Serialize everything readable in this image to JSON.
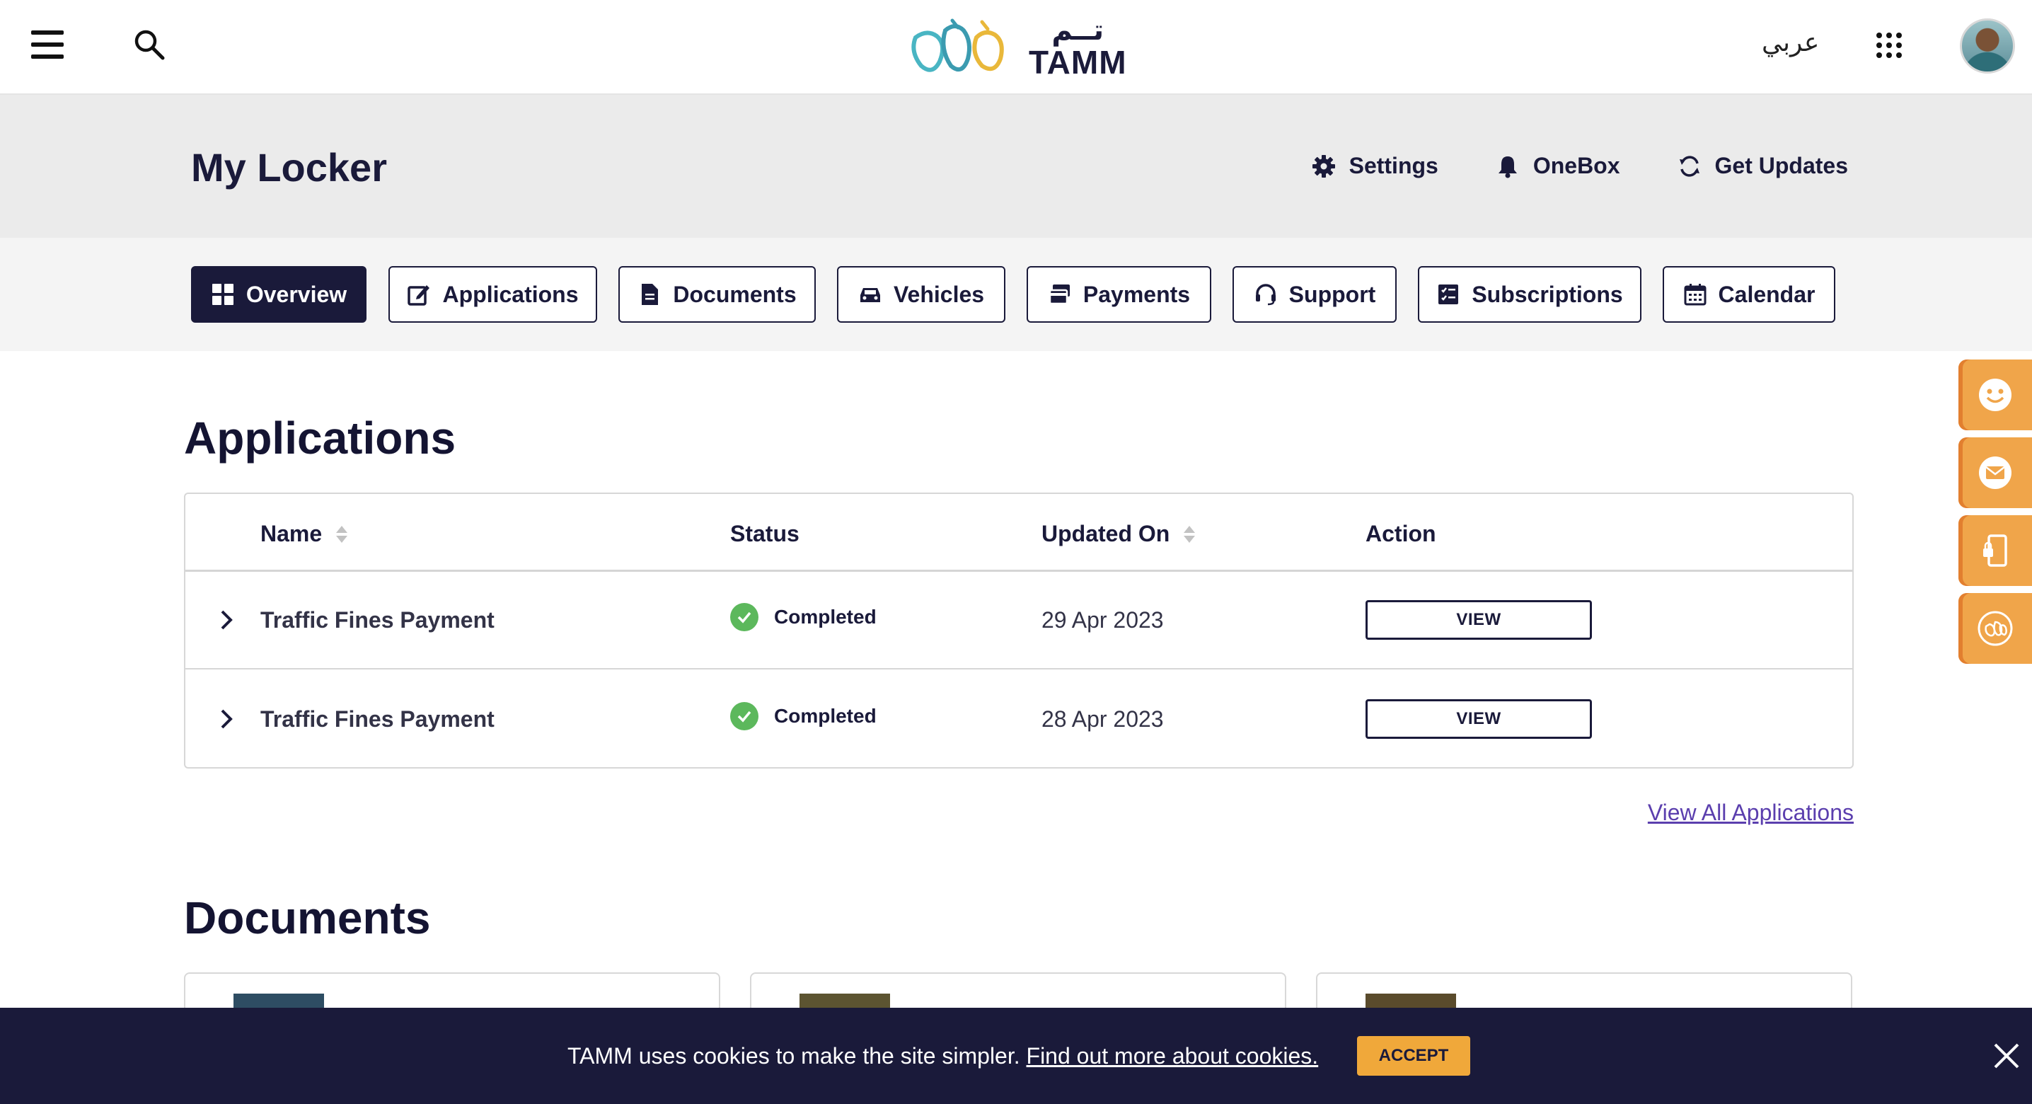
{
  "header": {
    "logo_arabic": "تــم",
    "logo_text": "TAMM",
    "language_toggle": "عربي"
  },
  "locker": {
    "title": "My Locker",
    "actions": [
      {
        "label": "Settings",
        "icon": "gear-icon"
      },
      {
        "label": "OneBox",
        "icon": "bell-icon"
      },
      {
        "label": "Get Updates",
        "icon": "refresh-icon"
      }
    ]
  },
  "tabs": [
    {
      "label": "Overview",
      "icon": "grid-icon",
      "active": true
    },
    {
      "label": "Applications",
      "icon": "edit-icon",
      "active": false
    },
    {
      "label": "Documents",
      "icon": "document-icon",
      "active": false
    },
    {
      "label": "Vehicles",
      "icon": "car-icon",
      "active": false
    },
    {
      "label": "Payments",
      "icon": "payments-icon",
      "active": false
    },
    {
      "label": "Support",
      "icon": "headset-icon",
      "active": false
    },
    {
      "label": "Subscriptions",
      "icon": "checklist-icon",
      "active": false
    },
    {
      "label": "Calendar",
      "icon": "calendar-icon",
      "active": false
    }
  ],
  "applications": {
    "title": "Applications",
    "columns": {
      "name": "Name",
      "status": "Status",
      "updated": "Updated On",
      "action": "Action"
    },
    "rows": [
      {
        "name": "Traffic Fines Payment",
        "status": "Completed",
        "updated": "29 Apr 2023",
        "action": "VIEW"
      },
      {
        "name": "Traffic Fines Payment",
        "status": "Completed",
        "updated": "28 Apr 2023",
        "action": "VIEW"
      }
    ],
    "view_all": "View All Applications"
  },
  "documents": {
    "title": "Documents",
    "thumb_colors": [
      "#2e4d63",
      "#5c5431",
      "#5a4b2c"
    ]
  },
  "cookie": {
    "text": "TAMM uses cookies to make the site simpler.",
    "link": "Find out more about cookies.",
    "accept": "ACCEPT"
  },
  "side_buttons": [
    "smiley-icon",
    "mail-icon",
    "mobile-lock-icon",
    "tamm-logo-icon"
  ],
  "colors": {
    "navy": "#1a1a3a",
    "accent_orange": "#f0a54a",
    "success_green": "#5cb85c",
    "link_purple": "#5b3fae"
  }
}
